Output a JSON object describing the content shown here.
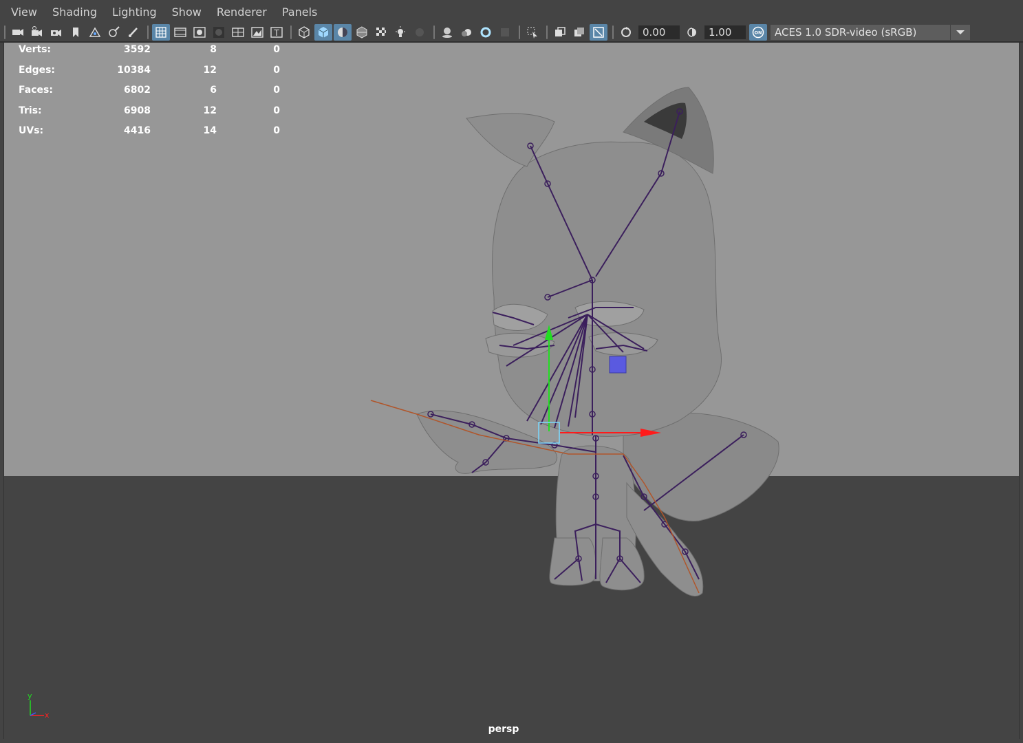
{
  "menu": [
    "View",
    "Shading",
    "Lighting",
    "Show",
    "Renderer",
    "Panels"
  ],
  "toolbar": {
    "exposure": "0.00",
    "gamma": "1.00",
    "color_management_badge": "ON",
    "color_space": "ACES 1.0 SDR-video (sRGB)",
    "icons": [
      "select-camera-icon",
      "camera-attributes-icon",
      "bookmarks-icon",
      "bookmark-icon",
      "image-plane-icon",
      "grease-pencil-icon",
      "paint-icon",
      "grid-icon",
      "film-gate-icon",
      "resolution-gate-icon",
      "gate-mask-icon",
      "field-chart-icon",
      "safe-action-icon",
      "safe-title-icon",
      "wireframe-icon",
      "smooth-shade-icon",
      "default-material-icon",
      "wireframe-on-shaded-icon",
      "textured-icon",
      "use-all-lights-icon",
      "shadows-icon",
      "screen-space-ao-icon",
      "motion-blur-icon",
      "multisample-aa-icon",
      "depth-of-field-icon",
      "isolate-select-icon",
      "xray-icon",
      "xray-active-icon",
      "xray-joints-icon",
      "backface-icon",
      "exposure-icon",
      "gamma-icon",
      "color-management-icon"
    ]
  },
  "hud": {
    "rows": [
      {
        "label": "Verts:",
        "c1": "3592",
        "c2": "8",
        "c3": "0"
      },
      {
        "label": "Edges:",
        "c1": "10384",
        "c2": "12",
        "c3": "0"
      },
      {
        "label": "Faces:",
        "c1": "6802",
        "c2": "6",
        "c3": "0"
      },
      {
        "label": "Tris:",
        "c1": "6908",
        "c2": "12",
        "c3": "0"
      },
      {
        "label": "UVs:",
        "c1": "4416",
        "c2": "14",
        "c3": "0"
      }
    ]
  },
  "axis": {
    "y": "y",
    "x": "x"
  },
  "camera": "persp",
  "colors": {
    "viewport_bg": "#979797",
    "ground": "#444444",
    "joint": "#3b1f5c",
    "manip_x": "#ff1a1a",
    "manip_y": "#22dd22",
    "manip_center": "#7ad8ff",
    "accent": "#5a86a8"
  }
}
